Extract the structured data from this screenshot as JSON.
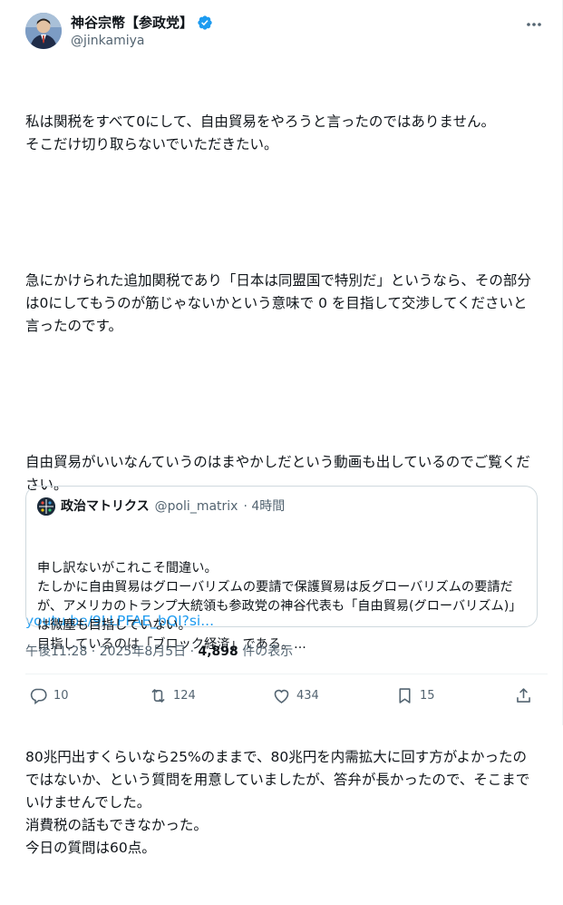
{
  "author": {
    "display_name": "神谷宗幣【参政党】",
    "handle": "@jinkamiya",
    "verified_icon": "verified-badge-icon",
    "brand_color": "#1d9bf0"
  },
  "post": {
    "paragraphs": [
      "私は関税をすべて0にして、自由貿易をやろうと言ったのではありません。\nそこだけ切り取らないでいただきたい。",
      "急にかけられた追加関税であり「日本は同盟国で特別だ」というなら、その部分は0にしてもうのが筋じゃないかという意味で 0 を目指して交渉してくださいと言ったのです。",
      "自由貿易がいいなんていうのはまやかしだという動画も出しているのでご覧ください。"
    ],
    "link_text": "youtu.be/9LLPFAE_bQI?si...",
    "closing": "80兆円出すくらいなら25%のままで、80兆円を内需拡大に回す方がよかったのではないか、という質問を用意していましたが、答弁が長かったので、そこまでいけませんでした。\n消費税の話もできなかった。\n今日の質問は60点。"
  },
  "quote": {
    "display_name": "政治マトリクス",
    "handle": "@poli_matrix",
    "time": "· 4時間",
    "text": "申し訳ないがこれこそ間違い。\nたしかに自由貿易はグローバリズムの要請で保護貿易は反グローバリズムの要請だが、アメリカのトランプ大統領も参政党の神谷代表も「自由貿易(グローバリズム)」は微塵も目指していない。\n目指しているのは「ブロック経済」である。..."
  },
  "meta": {
    "timestamp": "午後11:28 · 2025年8月5日 · ",
    "views_count": "4,898",
    "views_label": " 件の表示"
  },
  "actions": {
    "replies": "10",
    "reposts": "124",
    "likes": "434",
    "bookmarks": "15"
  }
}
